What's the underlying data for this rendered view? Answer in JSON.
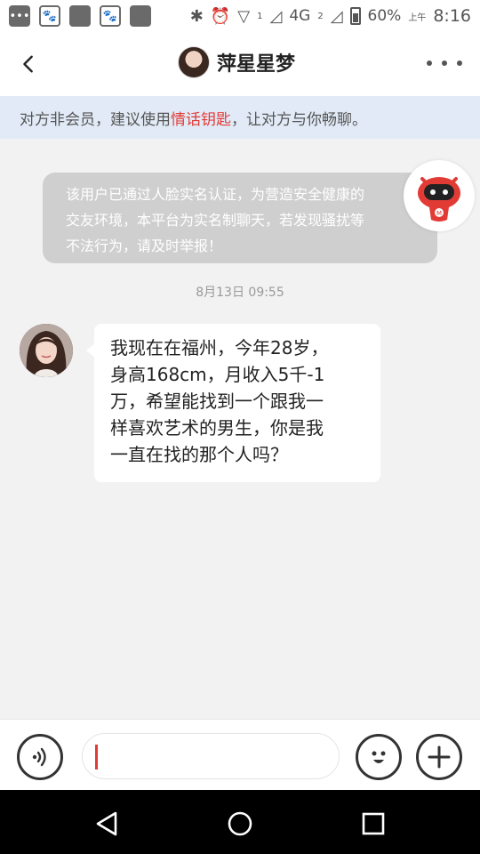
{
  "status_bar": {
    "battery": "60%",
    "network": "4G",
    "network_sub": "2",
    "signal_sub": "1",
    "am_pm": "上午",
    "time": "8:16"
  },
  "header": {
    "title": "萍星星梦",
    "back_icon": "chevron-left-icon",
    "more_icon": "more-horizontal-icon"
  },
  "notice": {
    "prefix": "对方非会员，建议使用",
    "highlight": "情话钥匙",
    "suffix": "，让对方与你畅聊。",
    "highlight_color": "#e23b36"
  },
  "system_message": {
    "line1": "该用户已通过人脸实名认证，为营造安全健康的",
    "line2": "交友环境，本平台为实名制聊天，若发现骚扰等",
    "line3": "不法行为，请及时举报！"
  },
  "timestamp": "8月13日 09:55",
  "chat": {
    "lines": [
      "我现在在福州，今年28岁，",
      "身高168cm，月收入5千-1",
      "万，希望能找到一个跟我一",
      "样喜欢艺术的男生，你是我",
      "一直在找的那个人吗？"
    ]
  },
  "input_bar": {
    "voice_icon": "voice-icon",
    "emoji_icon": "emoji-icon",
    "plus_icon": "plus-icon",
    "placeholder": ""
  },
  "colors": {
    "accent": "#e23b36",
    "notice_bg": "#e1eaf6",
    "system_bubble": "#cfcfcf"
  }
}
